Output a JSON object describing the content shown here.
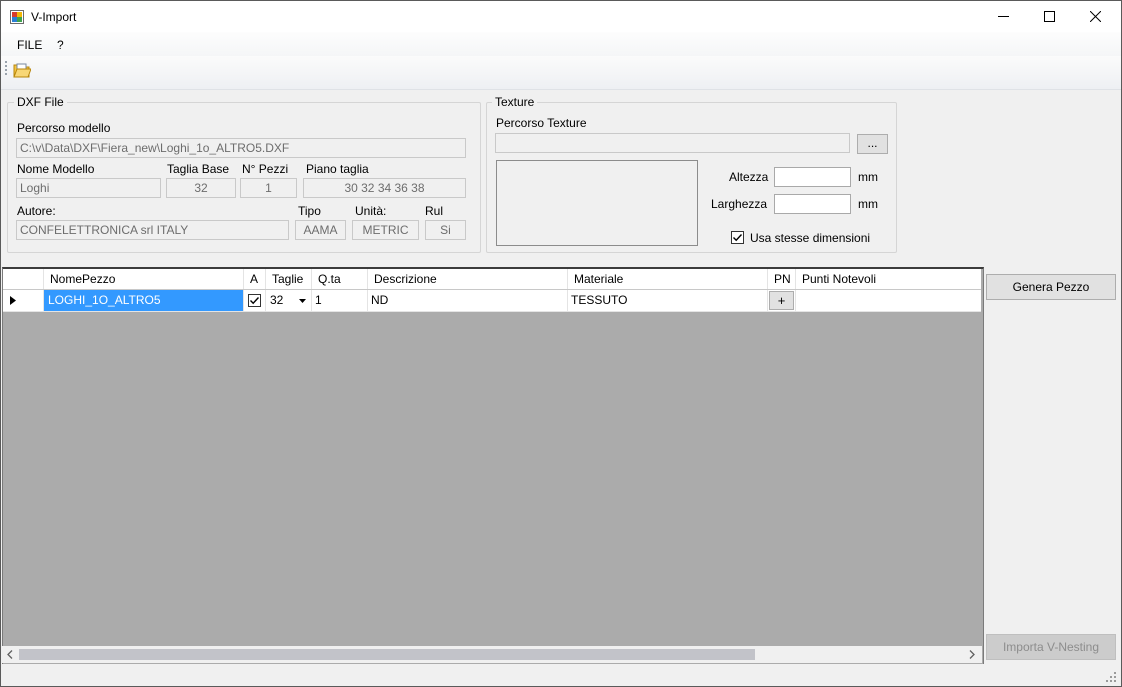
{
  "window": {
    "title": "V-Import"
  },
  "menu": {
    "file": "FILE",
    "help": "?"
  },
  "dxf": {
    "group_title": "DXF File",
    "path_label": "Percorso modello",
    "path_value": "C:\\v\\Data\\DXF\\Fiera_new\\Loghi_1o_ALTRO5.DXF",
    "name_label": "Nome Modello",
    "name_value": "Loghi",
    "base_size_label": "Taglia Base",
    "base_size_value": "32",
    "pieces_label": "N° Pezzi",
    "pieces_value": "1",
    "cut_plan_label": "Piano taglia",
    "cut_plan_value": "30 32 34 36 38",
    "author_label": "Autore:",
    "author_value": "CONFELETTRONICA srl ITALY",
    "type_label": "Tipo",
    "type_value": "AAMA",
    "unit_label": "Unità:",
    "unit_value": "METRIC",
    "rul_label": "Rul",
    "rul_value": "Si"
  },
  "texture": {
    "group_title": "Texture",
    "path_label": "Percorso Texture",
    "path_value": "",
    "browse_label": "...",
    "height_label": "Altezza",
    "height_value": "",
    "width_label": "Larghezza",
    "width_value": "",
    "unit_mm": "mm",
    "same_dims_label": "Usa stesse dimensioni",
    "same_dims_checked": true
  },
  "grid": {
    "columns": [
      "NomePezzo",
      "A",
      "Taglie",
      "Q.ta",
      "Descrizione",
      "Materiale",
      "PN",
      "Punti Notevoli"
    ],
    "rows": [
      {
        "nome": "LOGHI_1O_ALTRO5",
        "a": true,
        "taglie": "32",
        "qta": "1",
        "descrizione": "ND",
        "materiale": "TESSUTO",
        "pn": "+",
        "punti": ""
      }
    ]
  },
  "actions": {
    "generate": "Genera Pezzo",
    "import": "Importa V-Nesting"
  }
}
